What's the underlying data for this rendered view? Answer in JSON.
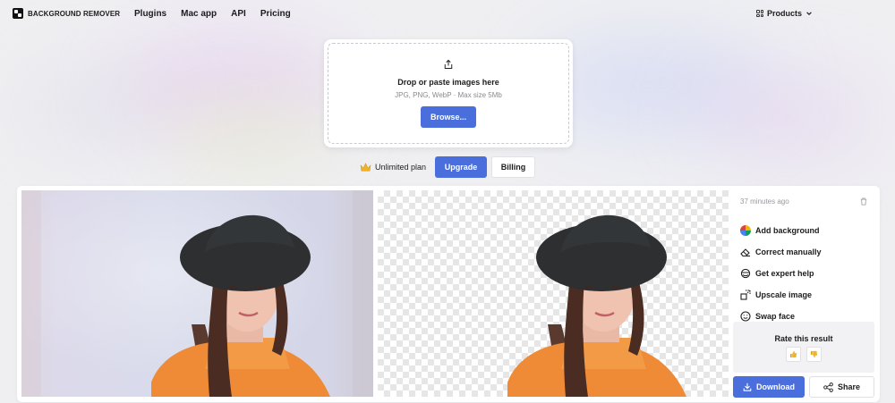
{
  "brand": {
    "name": "BACKGROUND REMOVER",
    "logo_icon": "logo-icon"
  },
  "nav": {
    "items": [
      "Plugins",
      "Mac app",
      "API",
      "Pricing"
    ],
    "products_label": "Products",
    "products_icon": "grid-icon",
    "products_chevron": "chevron-down-icon"
  },
  "upload": {
    "icon": "upload-icon",
    "title": "Drop or paste images here",
    "subtitle": "JPG, PNG, WebP · Max size 5Mb",
    "browse_label": "Browse..."
  },
  "plan": {
    "icon": "crown-icon",
    "label": "Unlimited plan",
    "upgrade_label": "Upgrade",
    "billing_label": "Billing"
  },
  "result": {
    "timestamp": "37 minutes ago",
    "delete_icon": "trash-icon",
    "actions": [
      {
        "label": "Add background",
        "icon": "color-wheel-icon"
      },
      {
        "label": "Correct manually",
        "icon": "eraser-icon"
      },
      {
        "label": "Get expert help",
        "icon": "expert-icon"
      },
      {
        "label": "Upscale image",
        "icon": "upscale-icon"
      },
      {
        "label": "Swap face",
        "icon": "smiley-icon"
      }
    ],
    "rate_title": "Rate this result",
    "thumbs_up_icon": "thumbs-up-icon",
    "thumbs_down_icon": "thumbs-down-icon",
    "download_label": "Download",
    "download_icon": "download-icon",
    "share_label": "Share",
    "share_icon": "share-icon"
  },
  "colors": {
    "accent": "#4a6fdc",
    "sweater": "#f0903a",
    "hat": "#2d2f31"
  }
}
